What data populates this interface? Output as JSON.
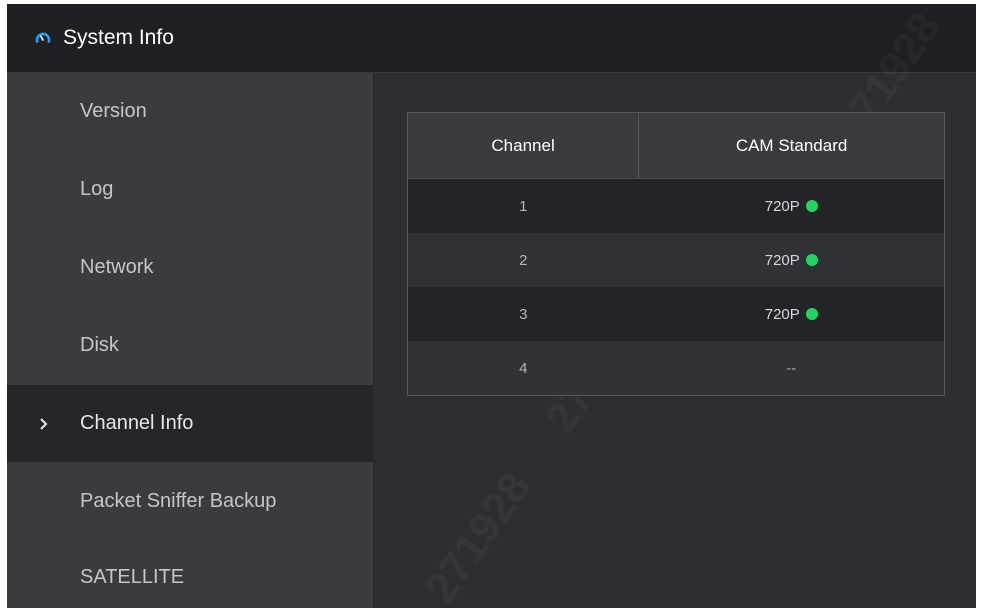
{
  "window": {
    "title": "System Info",
    "title_icon": "gauge-icon",
    "accent": "#1ea3ff"
  },
  "sidebar": {
    "items": [
      {
        "label": "Version",
        "active": false
      },
      {
        "label": "Log",
        "active": false
      },
      {
        "label": "Network",
        "active": false
      },
      {
        "label": "Disk",
        "active": false
      },
      {
        "label": "Channel Info",
        "active": true
      },
      {
        "label": "Packet Sniffer Backup",
        "active": false
      },
      {
        "label": "SATELLITE",
        "active": false
      }
    ],
    "active_icon": "chevron-right-icon"
  },
  "channel_table": {
    "headers": [
      "Channel",
      "CAM Standard"
    ],
    "rows": [
      {
        "channel": "1",
        "standard": "720P",
        "status": "online"
      },
      {
        "channel": "2",
        "standard": "720P",
        "status": "online"
      },
      {
        "channel": "3",
        "standard": "720P",
        "status": "online"
      },
      {
        "channel": "4",
        "standard": "--",
        "status": "none"
      }
    ],
    "status_color": "#1ed760"
  },
  "watermark": {
    "text": "271928"
  }
}
